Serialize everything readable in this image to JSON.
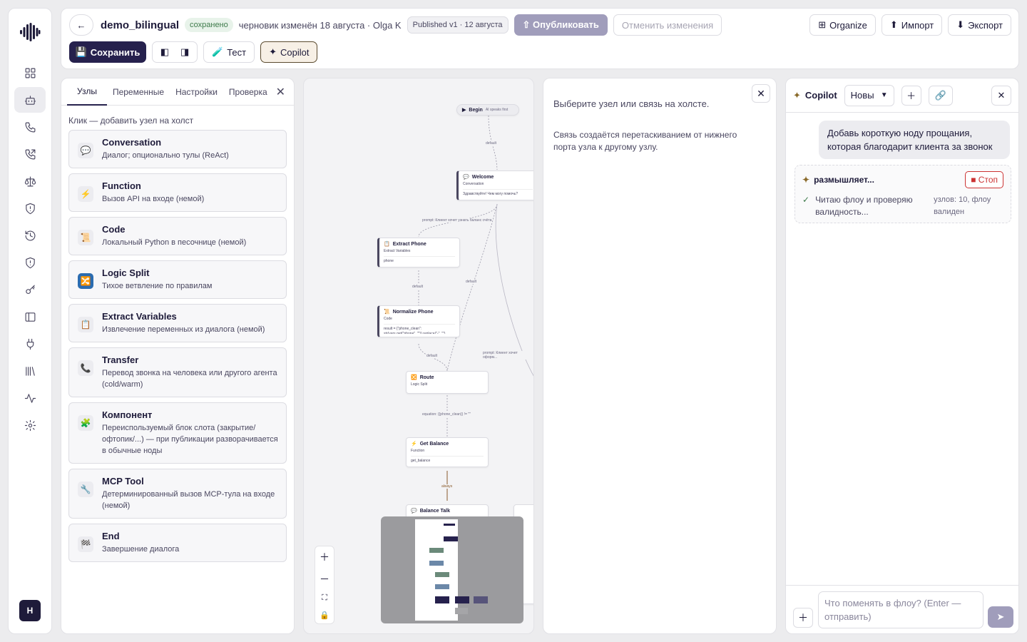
{
  "header": {
    "back_icon": "←",
    "title": "demo_bilingual",
    "saved_badge": "сохранено",
    "draft_info": "черновик изменён 18 августа · Olga K",
    "published_badge": "Published v1 · 12 августа",
    "publish_label": "⇧ Опубликовать",
    "revert_label": "Отменить изменения",
    "organize_label": "Organize",
    "import_label": "Импорт",
    "export_label": "Экспорт",
    "save_label": "Сохранить",
    "test_label": "Тест",
    "copilot_label": "Copilot"
  },
  "left_panel": {
    "tabs": [
      "Узлы",
      "Переменные",
      "Настройки",
      "Проверка"
    ],
    "hint": "Клик — добавить узел на холст",
    "nodes": [
      {
        "title": "Conversation",
        "desc": "Диалог; опционально тулы (ReAct)",
        "icon": "chat-icon",
        "glyph": "💬"
      },
      {
        "title": "Function",
        "desc": "Вызов API на входе (немой)",
        "icon": "bolt-icon",
        "glyph": "⚡"
      },
      {
        "title": "Code",
        "desc": "Локальный Python в песочнице (немой)",
        "icon": "scroll-icon",
        "glyph": "📜"
      },
      {
        "title": "Logic Split",
        "desc": "Тихое ветвление по правилам",
        "icon": "shuffle-icon",
        "glyph": "🔀"
      },
      {
        "title": "Extract Variables",
        "desc": "Извлечение переменных из диалога (немой)",
        "icon": "clipboard-icon",
        "glyph": "📋"
      },
      {
        "title": "Transfer",
        "desc": "Перевод звонка на человека или другого агента (cold/warm)",
        "icon": "phone-icon",
        "glyph": "📞"
      },
      {
        "title": "Компонент",
        "desc": "Переиспользуемый блок слота (закрытие/офтопик/...) — при публикации разворачивается в обычные ноды",
        "icon": "puzzle-icon",
        "glyph": "🧩"
      },
      {
        "title": "MCP Tool",
        "desc": "Детерминированный вызов MCP-тула на входе (немой)",
        "icon": "wrench-icon",
        "glyph": "🔧"
      },
      {
        "title": "End",
        "desc": "Завершение диалога",
        "icon": "flag-icon",
        "glyph": "🏁"
      }
    ]
  },
  "canvas": {
    "begin": {
      "label": "Begin",
      "sub": "AI speaks first"
    },
    "welcome": {
      "title": "Welcome",
      "type": "Conversation",
      "body": "Здравствуйте! Чем могу помочь?"
    },
    "extract_phone": {
      "title": "Extract Phone",
      "type": "Extract Variables",
      "body": "phone"
    },
    "normalize_phone": {
      "title": "Normalize Phone",
      "type": "Code",
      "body": "result = {\"phone_clean\": str(vars.get(\"phone\", \"\")).replace(\"-\", \"\")..."
    },
    "route": {
      "title": "Route",
      "type": "Logic Split"
    },
    "get_balance": {
      "title": "Get Balance",
      "type": "Function",
      "body": "get_balance"
    },
    "balance_talk": {
      "title": "Balance Talk"
    },
    "edges": {
      "default": "default",
      "prompt_balance": "prompt: Клиент хочет узнать баланс счёта",
      "prompt_other": "prompt: Клиент хочет оформ...",
      "equation": "equation: {{phone_clean}} != \"\"",
      "always": "always"
    }
  },
  "mid_panel": {
    "text1": "Выберите узел или связь на холсте.",
    "text2": "Связь создаётся перетаскиванием от нижнего порта узла к другому узлу."
  },
  "copilot": {
    "title": "Copilot",
    "session_select": "Новы",
    "user_message": "Добавь короткую ноду прощания, которая благодарит клиента за звонок",
    "thinking_label": "размышляет...",
    "stop_label": "Стоп",
    "step_text": "Читаю флоу и проверяю валидность...",
    "step_meta": "узлов: 10, флоу валиден",
    "input_placeholder": "Что поменять в флоу? (Enter — отправить)"
  },
  "user": {
    "initial": "H"
  }
}
